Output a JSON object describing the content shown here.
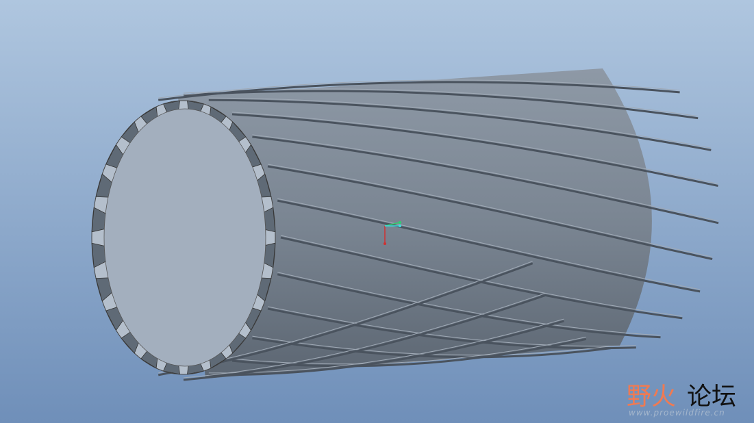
{
  "viewport": {
    "background_top": "#afc6df",
    "background_bottom": "#6f8fb9",
    "model_color": "#7d8896",
    "face_color": "#a3afbe"
  },
  "model": {
    "teeth_count": 24,
    "fin_count": 24
  },
  "watermark": {
    "brand_orange": "野火",
    "brand_black": "论坛",
    "url": "www.proewildfire.cn"
  }
}
